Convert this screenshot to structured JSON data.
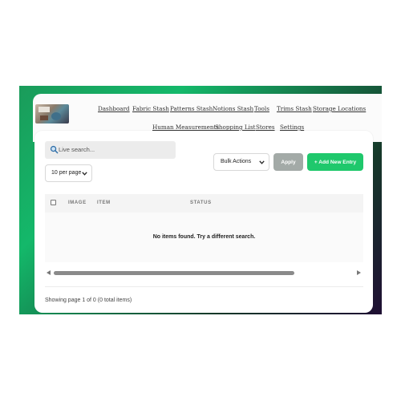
{
  "nav": {
    "items": [
      {
        "label": "Dashboard"
      },
      {
        "label": "Fabric Stash"
      },
      {
        "label": "Patterns Stash"
      },
      {
        "label": "Notions Stash"
      },
      {
        "label": "Tools"
      },
      {
        "label": "Trims Stash"
      },
      {
        "label": "Storage Locations"
      },
      {
        "label": "Human Measurements"
      },
      {
        "label": "Shopping List"
      },
      {
        "label": "Stores"
      },
      {
        "label": "Settings"
      }
    ]
  },
  "toolbar": {
    "search_placeholder": "Live search...",
    "per_page": "10 per page",
    "bulk_actions": "Bulk Actions",
    "apply_label": "Apply",
    "add_new_label": "+ Add New Entry"
  },
  "table": {
    "columns": [
      "IMAGE",
      "ITEM",
      "STATUS"
    ],
    "empty_message": "No items found. Try a different search."
  },
  "pagination": {
    "summary": "Showing page 1 of 0 (0 total items)"
  },
  "colors": {
    "accent_green": "#1fc86c",
    "apply_gray": "#a3aaa7",
    "frame_gradient_start": "#14b86a",
    "frame_gradient_end": "#1f0f33"
  },
  "icons": [
    "search-icon",
    "chevron-down-icon",
    "scroll-left-icon",
    "scroll-right-icon",
    "checkbox-icon"
  ]
}
